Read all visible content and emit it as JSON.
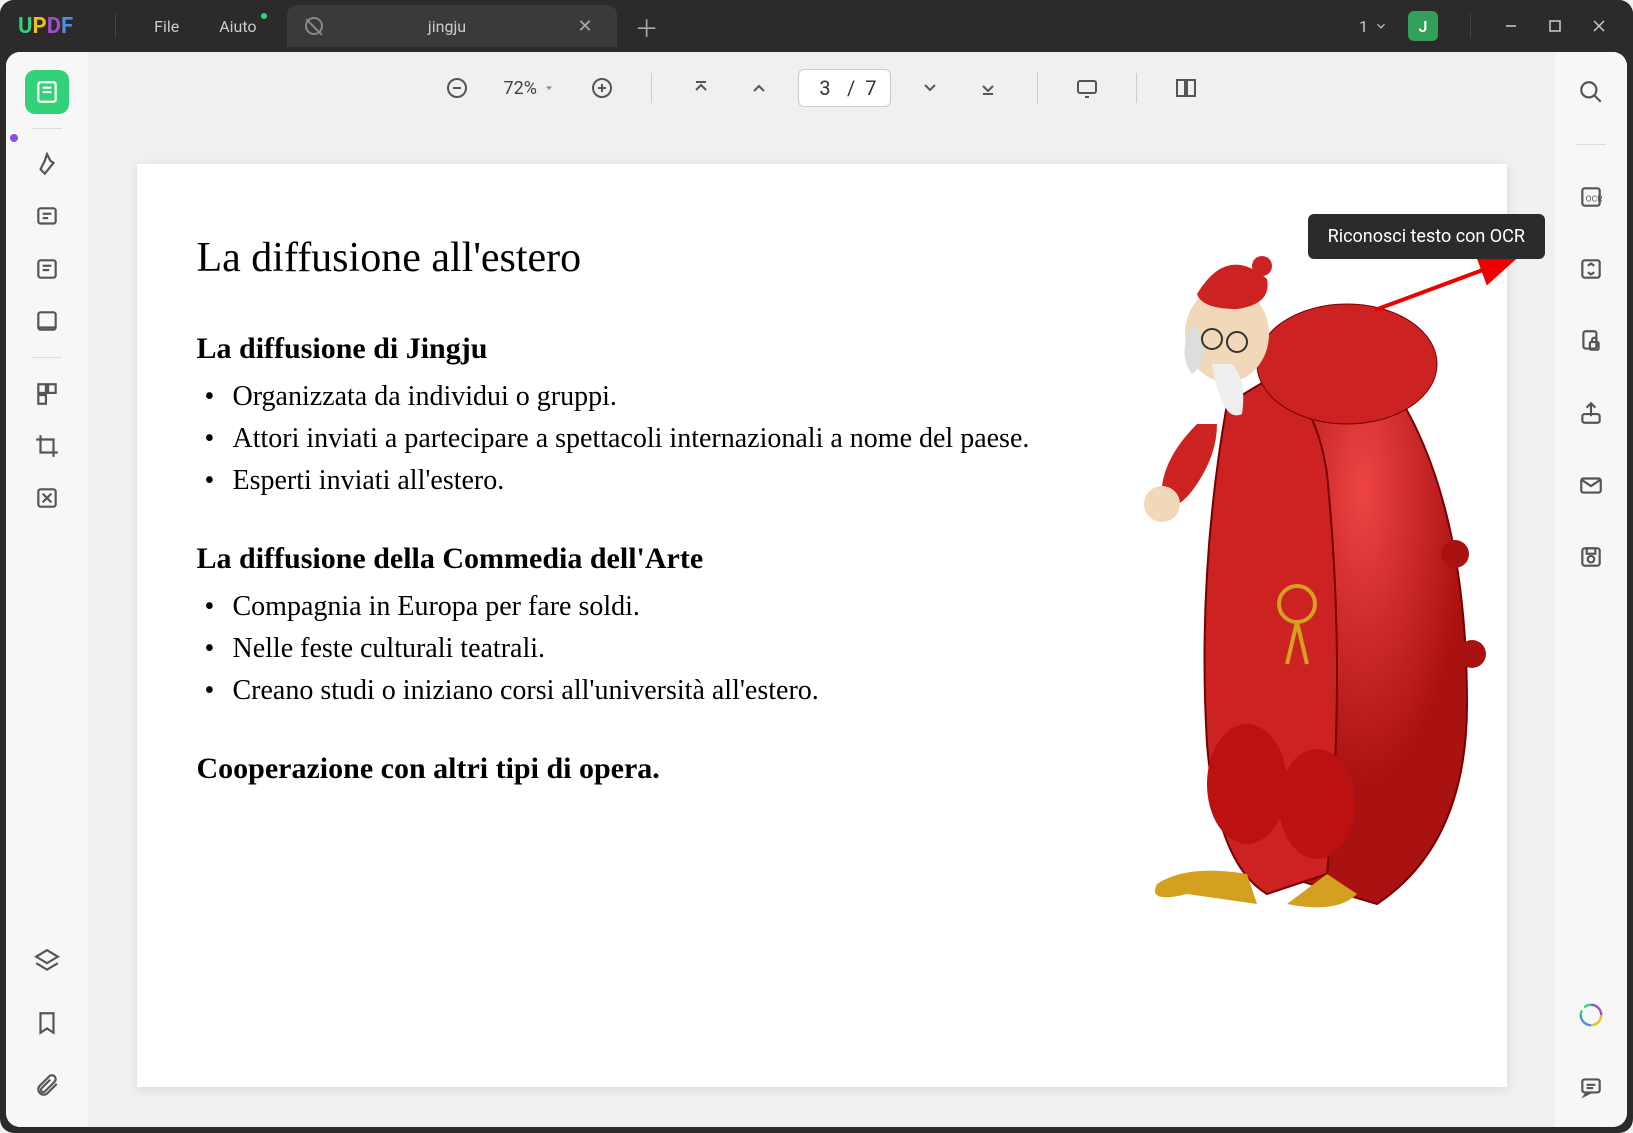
{
  "app": {
    "logo": "UPDF",
    "menu": {
      "file": "File",
      "help": "Aiuto"
    },
    "tab": {
      "title": "jingju"
    },
    "window_count": "1",
    "user_initial": "J"
  },
  "toolbar": {
    "zoom": "72%",
    "page_current": "3",
    "page_total": "7"
  },
  "tooltip": {
    "ocr": "Riconosci testo con OCR"
  },
  "document": {
    "title": "La diffusione all'estero",
    "sections": [
      {
        "heading": "La diffusione di Jingju",
        "items": [
          "Organizzata da individui o gruppi.",
          "Attori inviati a partecipare a spettacoli internazionali a nome del paese.",
          "Esperti inviati all'estero."
        ]
      },
      {
        "heading": "La diffusione della Commedia dell'Arte",
        "items": [
          "Compagnia in Europa per fare soldi.",
          "Nelle feste culturali teatrali.",
          "Creano studi o iniziano corsi all'università all'estero."
        ]
      }
    ],
    "footer_heading": "Cooperazione con altri tipi di opera.",
    "illustration_desc": "Pantalone character in red costume"
  },
  "icons": {
    "reader": "reader-mode",
    "highlight": "highlight",
    "comment": "comment",
    "edit": "edit",
    "form": "form",
    "organize": "organize",
    "crop": "crop",
    "redact": "redact",
    "layers": "layers",
    "bookmark": "bookmark",
    "attachment": "attachment",
    "search": "search",
    "ocr": "ocr",
    "convert": "convert",
    "protect": "protect",
    "share": "share",
    "email": "email",
    "save": "save",
    "assistant": "assistant",
    "feedback": "feedback"
  }
}
